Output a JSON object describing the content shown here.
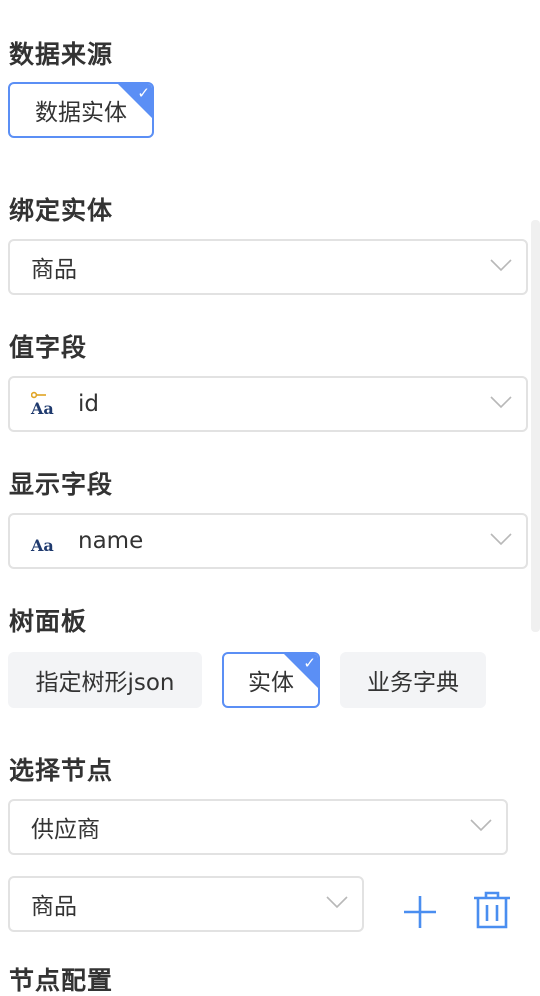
{
  "data_source": {
    "label": "数据来源",
    "options": [
      {
        "label": "数据实体",
        "selected": true
      }
    ]
  },
  "bind_entity": {
    "label": "绑定实体",
    "value": "商品"
  },
  "value_field": {
    "label": "值字段",
    "value": "id",
    "icon": "primary-key-text-field-icon"
  },
  "display_field": {
    "label": "显示字段",
    "value": "name",
    "icon": "text-field-icon"
  },
  "tree_panel": {
    "label": "树面板",
    "options": [
      {
        "label": "指定树形json",
        "selected": false
      },
      {
        "label": "实体",
        "selected": true
      },
      {
        "label": "业务字典",
        "selected": false
      }
    ]
  },
  "select_node": {
    "label": "选择节点",
    "nodes": [
      {
        "value": "供应商"
      },
      {
        "value": "商品"
      }
    ]
  },
  "next_section": {
    "label": "节点配置"
  },
  "colors": {
    "accent": "#5b8ff5",
    "border": "#e2e2e2",
    "chip_bg": "#f3f4f6",
    "icon_blue": "#4a8ef0"
  }
}
